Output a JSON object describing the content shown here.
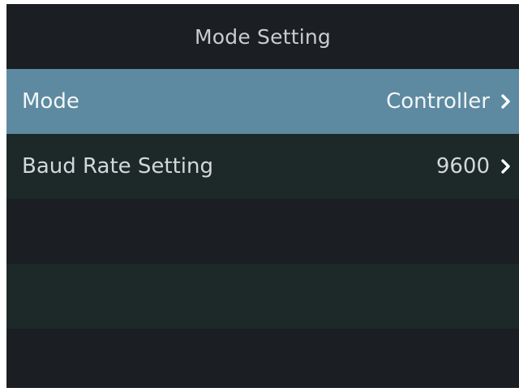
{
  "header": {
    "title": "Mode Setting"
  },
  "menu": {
    "items": [
      {
        "label": "Mode",
        "value": "Controller",
        "icon": "chevron-right-icon",
        "selected": true
      },
      {
        "label": "Baud Rate Setting",
        "value": "9600",
        "icon": "chevron-right-icon",
        "selected": false
      }
    ]
  },
  "colors": {
    "background": "#1b1e22",
    "row_alt": "#1c2928",
    "selected_row": "#5d8aa0",
    "text": "#d3d7db",
    "title_text": "#c9cdd1"
  }
}
